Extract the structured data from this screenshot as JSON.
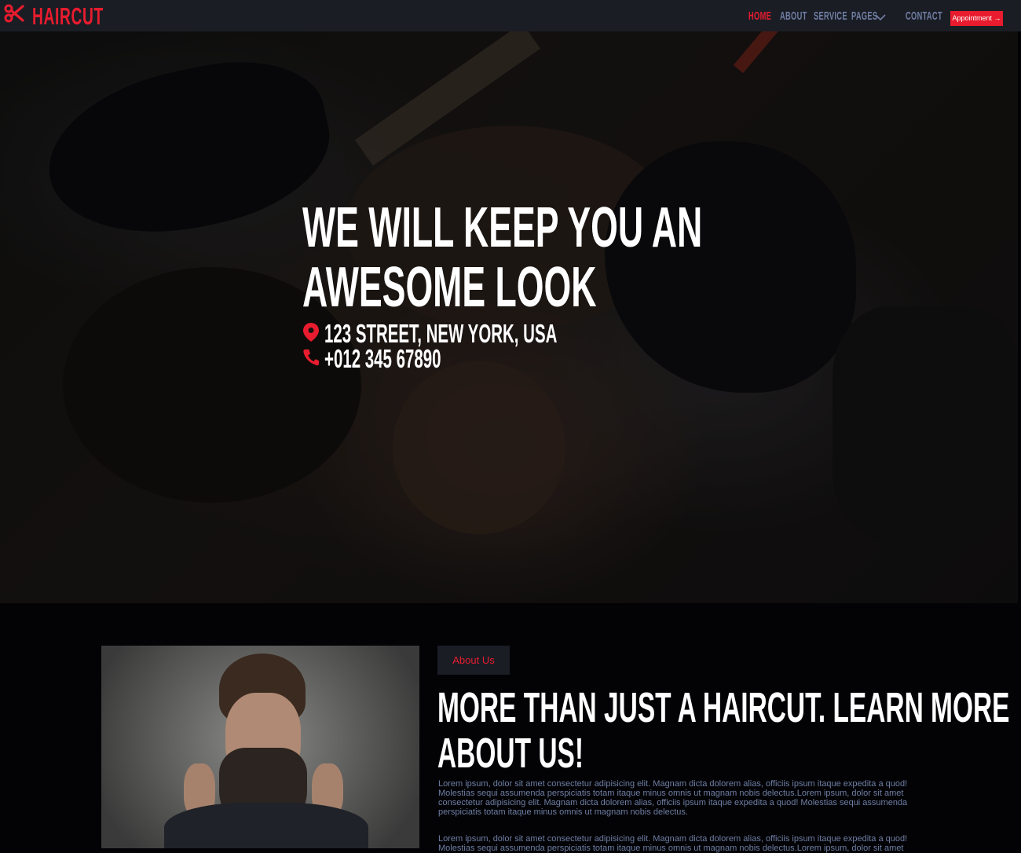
{
  "brand": {
    "name": "HAIRCUT",
    "icon": "scissors-icon",
    "accent_color": "#e81c2e"
  },
  "nav": {
    "items": [
      {
        "label": "HOME",
        "active": true
      },
      {
        "label": "ABOUT",
        "active": false
      },
      {
        "label": "SERVICE",
        "active": false
      },
      {
        "label": "PAGES",
        "active": false,
        "has_dropdown": true
      },
      {
        "label": "CONTACT",
        "active": false
      }
    ],
    "cta_label": "Appointment →"
  },
  "hero": {
    "title_line1": "WE WILL KEEP YOU AN",
    "title_line2": "AWESOME LOOK",
    "address": "123 STREET, NEW YORK, USA",
    "address_icon": "map-marker-icon",
    "phone": "+012 345 67890",
    "phone_icon": "phone-icon"
  },
  "about": {
    "badge": "About Us",
    "title_line1": "MORE THAN JUST A HAIRCUT. LEARN MORE",
    "title_line2": "ABOUT US!",
    "paragraph1": [
      "Lorem ipsum, dolor sit amet consectetur adipisicing elit. Magnam dicta dolorem alias, officiis ipsum itaque expedita a quod!",
      "Molestias sequi assumenda perspiciatis totam itaque minus omnis ut magnam nobis delectus.Lorem ipsum, dolor sit amet",
      "consectetur adipisicing elit. Magnam dicta dolorem alias, officiis ipsum itaque expedita a quod! Molestias sequi assumenda",
      "perspiciatis totam itaque minus omnis ut magnam nobis delectus."
    ],
    "paragraph2": [
      "Lorem ipsum, dolor sit amet consectetur adipisicing elit. Magnam dicta dolorem alias, officiis ipsum itaque expedita a quod!",
      "Molestias sequi assumenda perspiciatis totam itaque minus omnis ut magnam nobis delectus.Lorem ipsum, dolor sit amet"
    ]
  }
}
